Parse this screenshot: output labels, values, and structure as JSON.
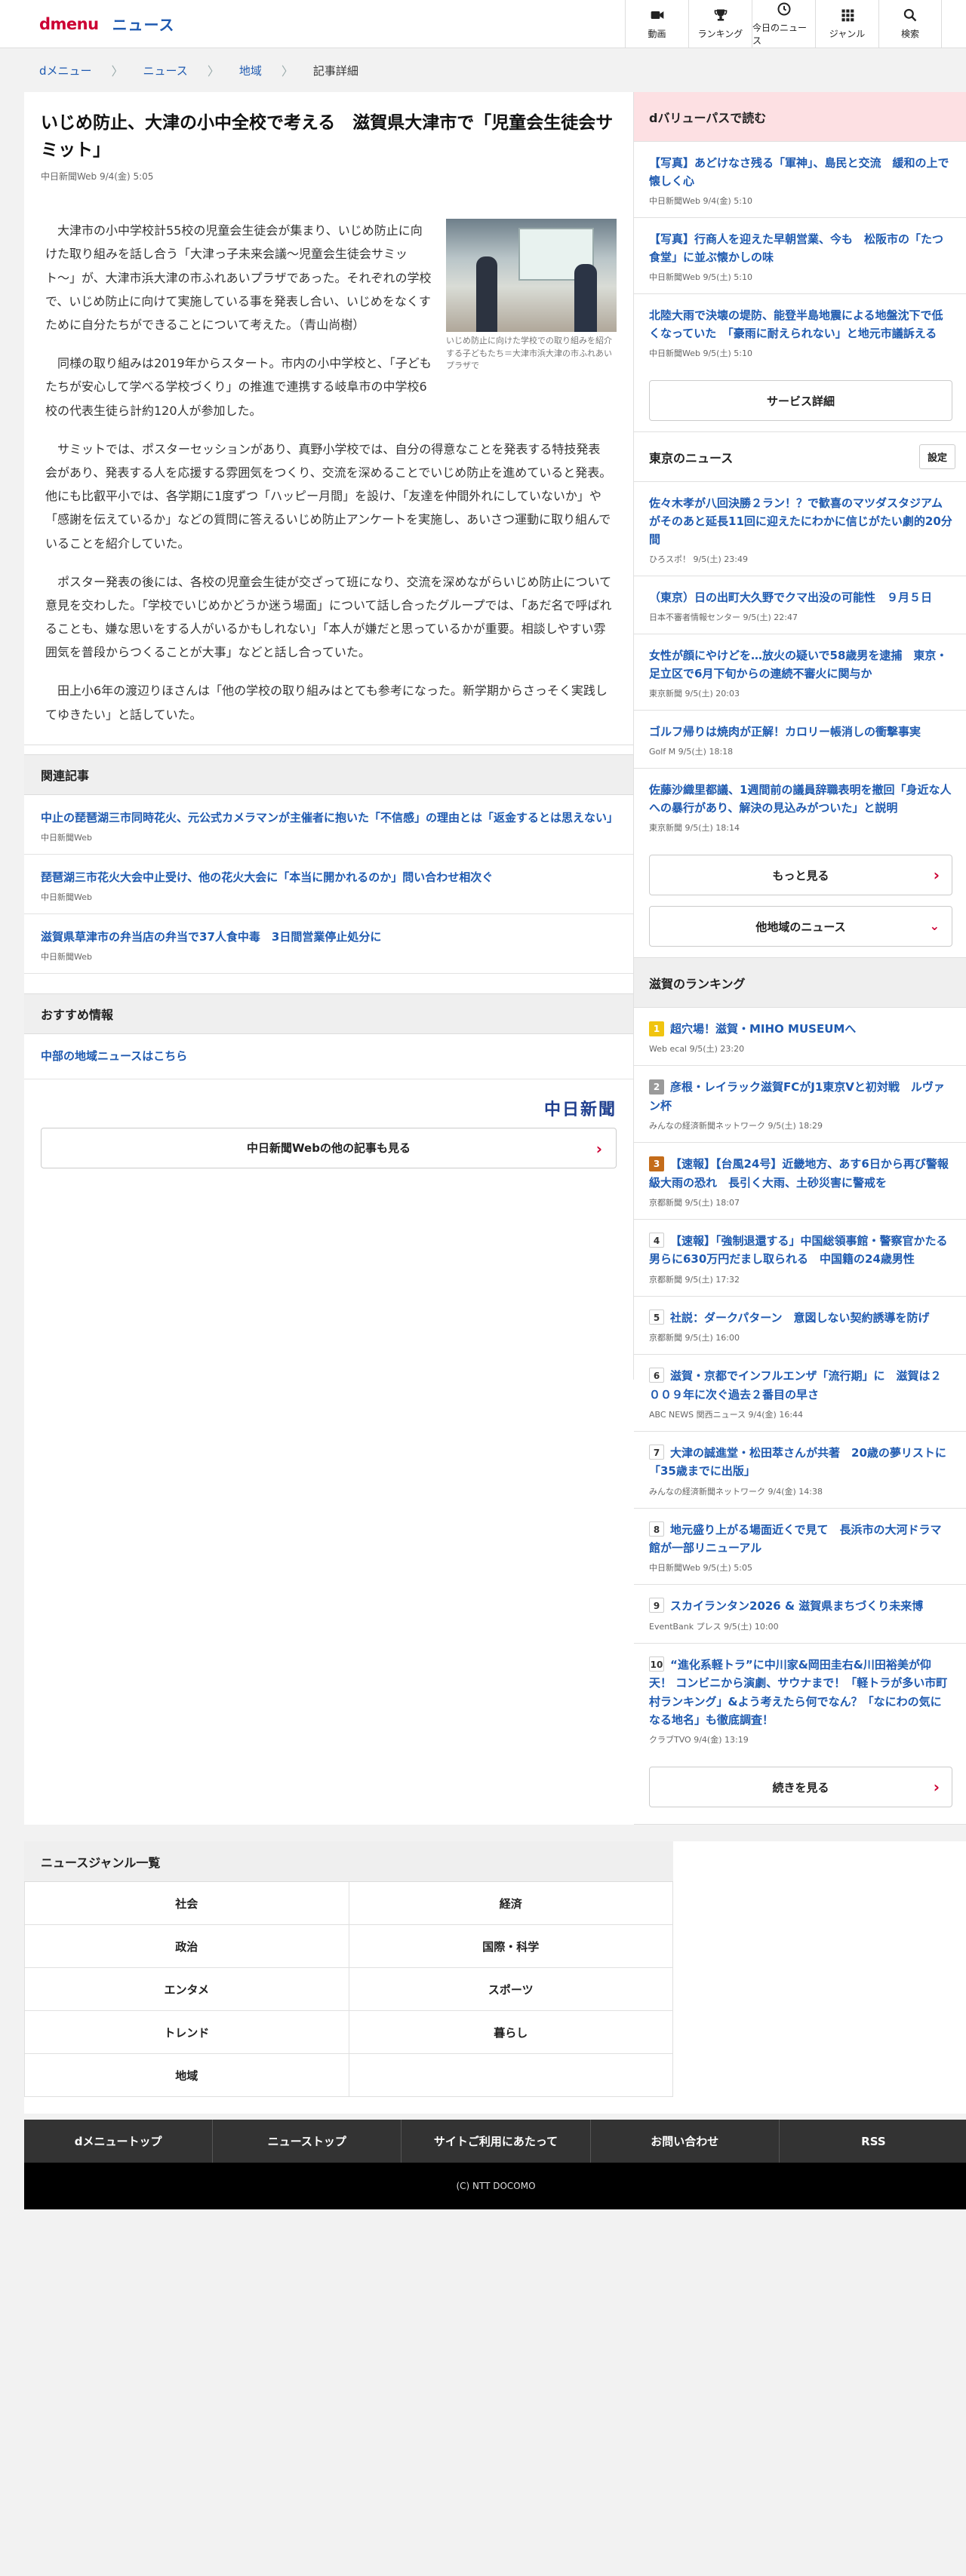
{
  "header": {
    "logo_d": "dmenu",
    "logo_news": "ニュース",
    "nav": [
      "動画",
      "ランキング",
      "今日のニュース",
      "ジャンル",
      "検索"
    ]
  },
  "breadcrumb": [
    "dメニュー",
    "ニュース",
    "地域",
    "記事詳細"
  ],
  "article": {
    "title": "いじめ防止、大津の小中全校で考える　滋賀県大津市で「児童会生徒会サミット」",
    "meta": "中日新聞Web 9/4(金) 5:05",
    "figure_caption": "いじめ防止に向けた学校での取り組みを紹介する子どもたち＝大津市浜大津の市ふれあいプラザで",
    "paragraphs": [
      "大津市の小中学校計55校の児童会生徒会が集まり、いじめ防止に向けた取り組みを話し合う「大津っ子未来会議〜児童会生徒会サミット〜」が、大津市浜大津の市ふれあいプラザであった。それぞれの学校で、いじめ防止に向けて実施している事を発表し合い、いじめをなくすために自分たちができることについて考えた。（青山尚樹）",
      "同様の取り組みは2019年からスタート。市内の小中学校と、「子どもたちが安心して学べる学校づくり」の推進で連携する岐阜市の中学校6校の代表生徒ら計約120人が参加した。",
      "サミットでは、ポスターセッションがあり、真野小学校では、自分の得意なことを発表する特技発表会があり、発表する人を応援する雰囲気をつくり、交流を深めることでいじめ防止を進めていると発表。他にも比叡平小では、各学期に1度ずつ「ハッピー月間」を設け、「友達を仲間外れにしていないか」や「感謝を伝えているか」などの質問に答えるいじめ防止アンケートを実施し、あいさつ運動に取り組んでいることを紹介していた。",
      "ポスター発表の後には、各校の児童会生徒が交ざって班になり、交流を深めながらいじめ防止について意見を交わした。「学校でいじめかどうか迷う場面」について話し合ったグループでは、「あだ名で呼ばれることも、嫌な思いをする人がいるかもしれない」「本人が嫌だと思っているかが重要。相談しやすい雰囲気を普段からつくることが大事」などと話し合っていた。",
      "田上小6年の渡辺りほさんは「他の学校の取り組みはとても参考になった。新学期からさっそく実践してゆきたい」と話していた。"
    ]
  },
  "related": {
    "heading": "関連記事",
    "items": [
      {
        "title": "中止の琵琶湖三市同時花火、元公式カメラマンが主催者に抱いた「不信感」の理由とは「返金するとは思えない」",
        "src": "中日新聞Web"
      },
      {
        "title": "琵琶湖三市花火大会中止受け、他の花火大会に「本当に開かれるのか」問い合わせ相次ぐ",
        "src": "中日新聞Web"
      },
      {
        "title": "滋賀県草津市の弁当店の弁当で37人食中毒　3日間営業停止処分に",
        "src": "中日新聞Web"
      }
    ]
  },
  "recommend": {
    "heading": "おすすめ情報",
    "link": "中部の地域ニュースはこちら",
    "publisher_logo": "中日新聞",
    "more_label": "中日新聞Webの他の記事も見る"
  },
  "sidebar": {
    "dvalue": {
      "heading": "dバリューパスで読む",
      "items": [
        {
          "title": "【写真】あどけなさ残る「軍神」、島民と交流　緩和の上で懐しく心",
          "src": "中日新聞Web 9/4(金) 5:10"
        },
        {
          "title": "【写真】行商人を迎えた早朝営業、今も　松阪市の「たつ食堂」に並ぶ懐かしの味",
          "src": "中日新聞Web 9/5(土) 5:10"
        },
        {
          "title": "北陸大雨で決壊の堤防、能登半島地震による地盤沈下で低くなっていた　「豪雨に耐えられない」と地元市議訴える",
          "src": "中日新聞Web 9/5(土) 5:10"
        }
      ],
      "button": "サービス詳細"
    },
    "tokyo": {
      "heading": "東京のニュース",
      "setting": "設定",
      "items": [
        {
          "title": "佐々木孝が八回決勝２ラン！？で歓喜のマツダスタジアムがそのあと延長11回に迎えたにわかに信じがたい劇的20分間",
          "src": "ひろスポ！ 9/5(土) 23:49"
        },
        {
          "title": "（東京）日の出町大久野でクマ出没の可能性　９月５日",
          "src": "日本不審者情報センター 9/5(土) 22:47"
        },
        {
          "title": "女性が顔にやけどを…放火の疑いで58歳男を逮捕　東京・足立区で6月下旬からの連続不審火に関与か",
          "src": "東京新聞 9/5(土) 20:03"
        },
        {
          "title": "ゴルフ帰りは焼肉が正解！カロリー帳消しの衝撃事実",
          "src": "Golf M 9/5(土) 18:18"
        },
        {
          "title": "佐藤沙織里都議、1週間前の議員辞職表明を撤回「身近な人への暴行があり、解決の見込みがついた」と説明",
          "src": "東京新聞 9/5(土) 18:14"
        }
      ],
      "more": "もっと見る",
      "other": "他地域のニュース"
    },
    "ranking": {
      "heading": "滋賀のランキング",
      "items": [
        {
          "rank": "1",
          "title": "超穴場！滋賀・MIHO MUSEUMへ",
          "src": "Web ecal 9/5(土) 23:20"
        },
        {
          "rank": "2",
          "title": "彦根・レイラック滋賀FCがJ1東京Vと初対戦　ルヴァン杯",
          "src": "みんなの経済新聞ネットワーク 9/5(土) 18:29"
        },
        {
          "rank": "3",
          "title": "【速報】【台風24号】近畿地方、あす6日から再び警報級大雨の恐れ　長引く大雨、土砂災害に警戒を",
          "src": "京都新聞 9/5(土) 18:07"
        },
        {
          "rank": "4",
          "title": "【速報】「強制退還する」中国総領事館・警察官かたる男らに630万円だまし取られる　中国籍の24歳男性",
          "src": "京都新聞 9/5(土) 17:32"
        },
        {
          "rank": "5",
          "title": "社説：ダークパターン　意図しない契約誘導を防げ",
          "src": "京都新聞 9/5(土) 16:00"
        },
        {
          "rank": "6",
          "title": "滋賀・京都でインフルエンザ「流行期」に　滋賀は２００９年に次ぐ過去２番目の早さ",
          "src": "ABC NEWS 関西ニュース 9/4(金) 16:44"
        },
        {
          "rank": "7",
          "title": "大津の誠進堂・松田萃さんが共著　20歳の夢リストに「35歳までに出版」",
          "src": "みんなの経済新聞ネットワーク 9/4(金) 14:38"
        },
        {
          "rank": "8",
          "title": "地元盛り上がる場面近くで見て　長浜市の大河ドラマ館が一部リニューアル",
          "src": "中日新聞Web 9/5(土) 5:05"
        },
        {
          "rank": "9",
          "title": "スカイランタン2026 & 滋賀県まちづくり未来博",
          "src": "EventBank プレス 9/5(土) 10:00"
        },
        {
          "rank": "10",
          "title": "“進化系軽トラ”に中川家&岡田圭右&川田裕美が仰天！ コンビニから演劇、サウナまで！「軽トラが多い市町村ランキング」&よう考えたら何でなん？「なにわの気になる地名」も徹底調査！",
          "src": "クラブTVO 9/4(金) 13:19"
        }
      ],
      "button": "続きを見る"
    }
  },
  "genre": {
    "heading": "ニュースジャンル一覧",
    "items": [
      "社会",
      "経済",
      "政治",
      "国際・科学",
      "エンタメ",
      "スポーツ",
      "トレンド",
      "暮らし",
      "地域",
      ""
    ]
  },
  "footer": {
    "links": [
      "dメニュートップ",
      "ニューストップ",
      "サイトご利用にあたって",
      "お問い合わせ",
      "RSS"
    ],
    "copyright": "(C) NTT DOCOMO"
  }
}
